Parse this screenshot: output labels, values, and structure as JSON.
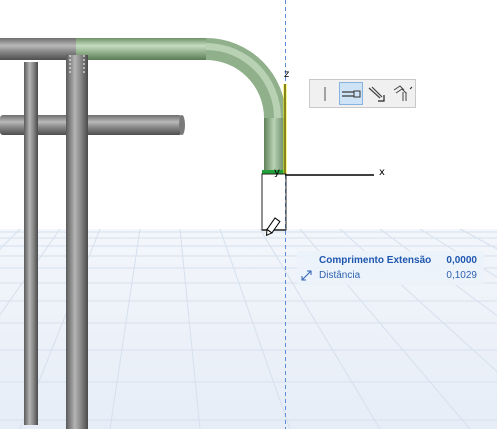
{
  "viewport": {
    "axes": {
      "x_label": "x",
      "y_label": "y",
      "z_label": "z"
    },
    "colors": {
      "selected_tube": "#8fb08a",
      "tube_gray": "#8e8e8e",
      "grid_line": "#d6e0ee",
      "guide_line": "#5b8ed8",
      "z_axis": "#f2ee1a",
      "y_axis": "#22a03a"
    }
  },
  "pet_palette": {
    "buttons": [
      {
        "icon": "vertical-line-icon",
        "active": false
      },
      {
        "icon": "extend-segment-icon",
        "active": true
      },
      {
        "icon": "offset-arrow-icon",
        "active": false
      },
      {
        "icon": "multi-offset-icon",
        "active": false
      }
    ]
  },
  "tracker": {
    "row1": {
      "label": "Comprimento Extensão",
      "value": "0,0000"
    },
    "row2": {
      "label": "Distância",
      "value": "0,1029",
      "icon": "diagonal-arrow-icon"
    }
  }
}
